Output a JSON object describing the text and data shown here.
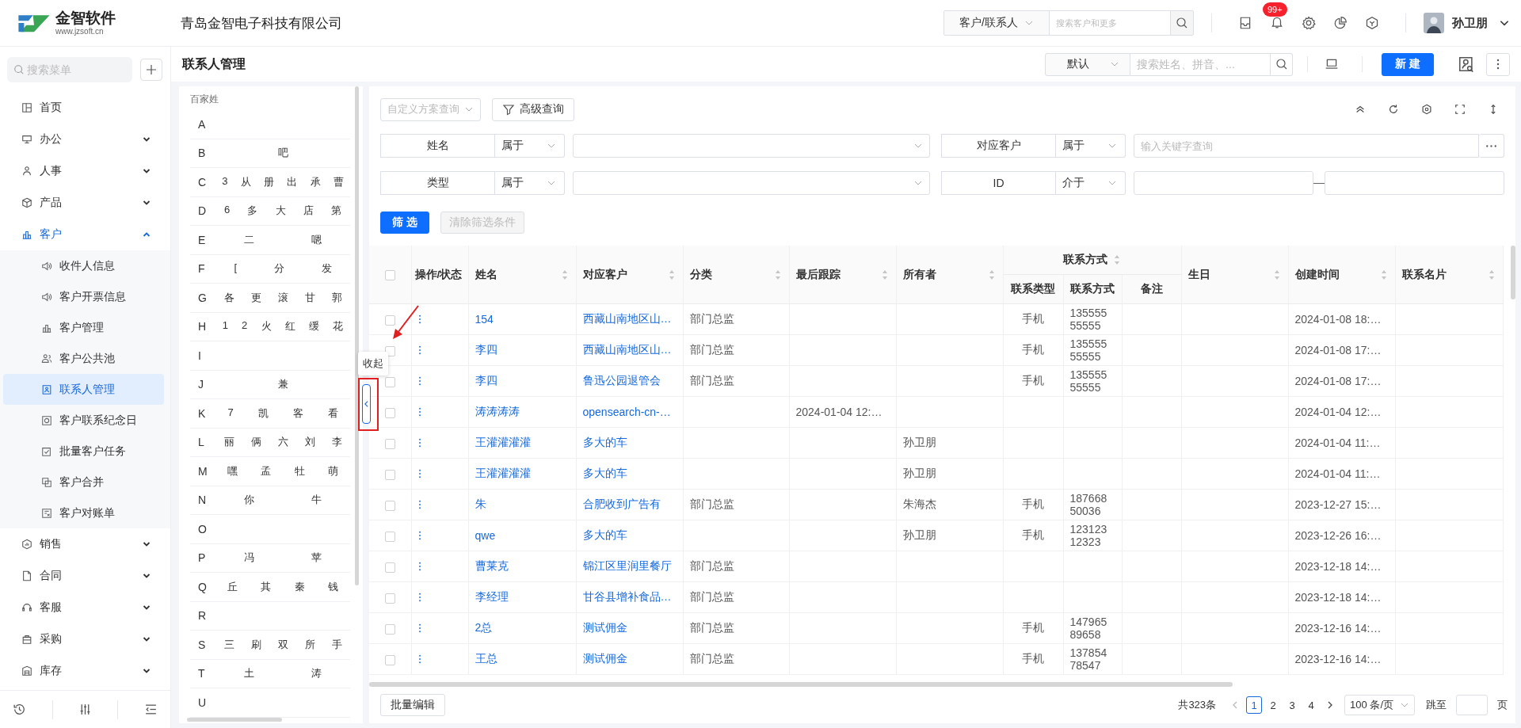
{
  "header": {
    "logo_name": "金智软件",
    "logo_url": "www.jzsoft.cn",
    "company": "青岛金智电子科技有限公司",
    "search_scope": "客户/联系人",
    "search_placeholder": "搜索客户和更多",
    "notification_badge": "99+",
    "user_name": "孙卫朋"
  },
  "sidebar": {
    "search_placeholder": "搜索菜单",
    "items": [
      {
        "label": "首页",
        "selected": false
      },
      {
        "label": "办公",
        "selected": false,
        "expanded": false
      },
      {
        "label": "人事",
        "selected": false,
        "expanded": false
      },
      {
        "label": "产品",
        "selected": false,
        "expanded": false
      },
      {
        "label": "客户",
        "selected": true,
        "expanded": true,
        "children": [
          {
            "label": "收件人信息",
            "selected": false
          },
          {
            "label": "客户开票信息",
            "selected": false
          },
          {
            "label": "客户管理",
            "selected": false
          },
          {
            "label": "客户公共池",
            "selected": false
          },
          {
            "label": "联系人管理",
            "selected": true
          },
          {
            "label": "客户联系纪念日",
            "selected": false
          },
          {
            "label": "批量客户任务",
            "selected": false
          },
          {
            "label": "客户合并",
            "selected": false
          },
          {
            "label": "客户对账单",
            "selected": false
          }
        ]
      },
      {
        "label": "销售",
        "selected": false,
        "expanded": false
      },
      {
        "label": "合同",
        "selected": false,
        "expanded": false
      },
      {
        "label": "客服",
        "selected": false,
        "expanded": false
      },
      {
        "label": "采购",
        "selected": false,
        "expanded": false
      },
      {
        "label": "库存",
        "selected": false,
        "expanded": false
      }
    ]
  },
  "page": {
    "title": "联系人管理",
    "scope": "默认",
    "search_placeholder": "搜索姓名、拼音、...",
    "new_button": "新 建"
  },
  "alphabet": {
    "title": "百家姓",
    "rows": [
      {
        "letter": "A"
      },
      {
        "letter": "B",
        "names": [
          "吧"
        ]
      },
      {
        "letter": "C",
        "names": [
          "3",
          "从",
          "册",
          "出",
          "承",
          "曹"
        ]
      },
      {
        "letter": "D",
        "names": [
          "6",
          "多",
          "大",
          "店",
          "第"
        ]
      },
      {
        "letter": "E",
        "names": [
          "二",
          "嗯"
        ]
      },
      {
        "letter": "F",
        "names": [
          "[",
          "分",
          "发"
        ]
      },
      {
        "letter": "G",
        "names": [
          "各",
          "更",
          "滚",
          "甘",
          "郭"
        ]
      },
      {
        "letter": "H",
        "names": [
          "1",
          "2",
          "火",
          "红",
          "缓",
          "花"
        ]
      },
      {
        "letter": "I"
      },
      {
        "letter": "J",
        "names": [
          "兼"
        ]
      },
      {
        "letter": "K",
        "names": [
          "7",
          "凯",
          "客",
          "看"
        ]
      },
      {
        "letter": "L",
        "names": [
          "丽",
          "俩",
          "六",
          "刘",
          "李"
        ]
      },
      {
        "letter": "M",
        "names": [
          "嘿",
          "孟",
          "牡",
          "萌"
        ]
      },
      {
        "letter": "N",
        "names": [
          "你",
          "牛"
        ]
      },
      {
        "letter": "O"
      },
      {
        "letter": "P",
        "names": [
          "冯",
          "苹"
        ]
      },
      {
        "letter": "Q",
        "names": [
          "丘",
          "其",
          "秦",
          "钱"
        ]
      },
      {
        "letter": "R"
      },
      {
        "letter": "S",
        "names": [
          "三",
          "刷",
          "双",
          "所",
          "手"
        ]
      },
      {
        "letter": "T",
        "names": [
          "土",
          "涛"
        ]
      },
      {
        "letter": "U"
      }
    ]
  },
  "collapse_tooltip": "收起",
  "filters": {
    "scheme_placeholder": "自定义方案查询",
    "advanced": "高级查询",
    "conditions": [
      {
        "field": "姓名",
        "operator": "属于",
        "kind": "select"
      },
      {
        "field": "对应客户",
        "operator": "属于",
        "kind": "keyword",
        "placeholder": "输入关键字查询"
      },
      {
        "field": "类型",
        "operator": "属于",
        "kind": "select"
      },
      {
        "field": "ID",
        "operator": "介于",
        "kind": "range"
      }
    ],
    "apply": "筛 选",
    "clear": {
      "label": "清除筛选条件",
      "disabled": true
    }
  },
  "table": {
    "all_checked": false,
    "columns": [
      {
        "label": "操作/状态",
        "sortable": false
      },
      {
        "label": "姓名",
        "sortable": true
      },
      {
        "label": "对应客户",
        "sortable": true
      },
      {
        "label": "分类",
        "sortable": true
      },
      {
        "label": "最后跟踪",
        "sortable": true
      },
      {
        "label": "所有者",
        "sortable": true
      },
      {
        "label": "联系方式",
        "sortable": true,
        "children": [
          {
            "label": "联系类型",
            "sortable": false
          },
          {
            "label": "联系方式",
            "sortable": false
          },
          {
            "label": "备注",
            "sortable": false
          }
        ]
      },
      {
        "label": "生日",
        "sortable": true
      },
      {
        "label": "创建时间",
        "sortable": true
      },
      {
        "label": "联系名片",
        "sortable": true
      }
    ],
    "rows": [
      {
        "checked": false,
        "name": "154",
        "customer": "西藏山南地区山…",
        "category": "部门总监",
        "contact_type": "手机",
        "contact": "13555555555",
        "created": "2024-01-08 18:…"
      },
      {
        "checked": false,
        "name": "李四",
        "customer": "西藏山南地区山…",
        "category": "部门总监",
        "contact_type": "手机",
        "contact": "13555555555",
        "created": "2024-01-08 17:…"
      },
      {
        "checked": false,
        "name": "李四",
        "customer": "鲁迅公园退管会",
        "category": "部门总监",
        "contact_type": "手机",
        "contact": "13555555555",
        "created": "2024-01-08 17:…"
      },
      {
        "checked": false,
        "name": "涛涛涛涛",
        "customer": "opensearch-cn-…",
        "last_follow": "2024-01-04 12:…",
        "created": "2024-01-04 12:…"
      },
      {
        "checked": false,
        "name": "王灌灌灌灌",
        "customer": "多大的车",
        "owner": "孙卫朋",
        "created": "2024-01-04 11:…"
      },
      {
        "checked": false,
        "name": "王灌灌灌灌",
        "customer": "多大的车",
        "owner": "孙卫朋",
        "created": "2024-01-04 11:…"
      },
      {
        "checked": false,
        "name": "朱",
        "customer": "合肥收到广告有",
        "category": "部门总监",
        "owner": "朱海杰",
        "contact_type": "手机",
        "contact": "18766850036",
        "created": "2023-12-27 15:…"
      },
      {
        "checked": false,
        "name": "qwe",
        "customer": "多大的车",
        "owner": "孙卫朋",
        "contact_type": "手机",
        "contact": "12312312323",
        "created": "2023-12-26 16:…"
      },
      {
        "checked": false,
        "name": "曹莱克",
        "customer": "锦江区里润里餐厅",
        "category": "部门总监",
        "created": "2023-12-18 14:…"
      },
      {
        "checked": false,
        "name": "李经理",
        "customer": "甘谷县增补食品…",
        "category": "部门总监",
        "created": "2023-12-18 14:…"
      },
      {
        "checked": false,
        "name": "2总",
        "customer": "测试佣金",
        "category": "部门总监",
        "contact_type": "手机",
        "contact": "14796589658",
        "created": "2023-12-16 14:…"
      },
      {
        "checked": false,
        "name": "王总",
        "customer": "测试佣金",
        "category": "部门总监",
        "contact_type": "手机",
        "contact": "13785478547",
        "created": "2023-12-16 14:…"
      }
    ]
  },
  "footer": {
    "batch_edit": "批量编辑",
    "total": "共323条",
    "pages": [
      {
        "label": "1",
        "selected": true
      },
      {
        "label": "2",
        "selected": false
      },
      {
        "label": "3",
        "selected": false
      },
      {
        "label": "4",
        "selected": false
      }
    ],
    "page_size": "100 条/页",
    "jump_label": "跳至",
    "page_unit": "页"
  }
}
